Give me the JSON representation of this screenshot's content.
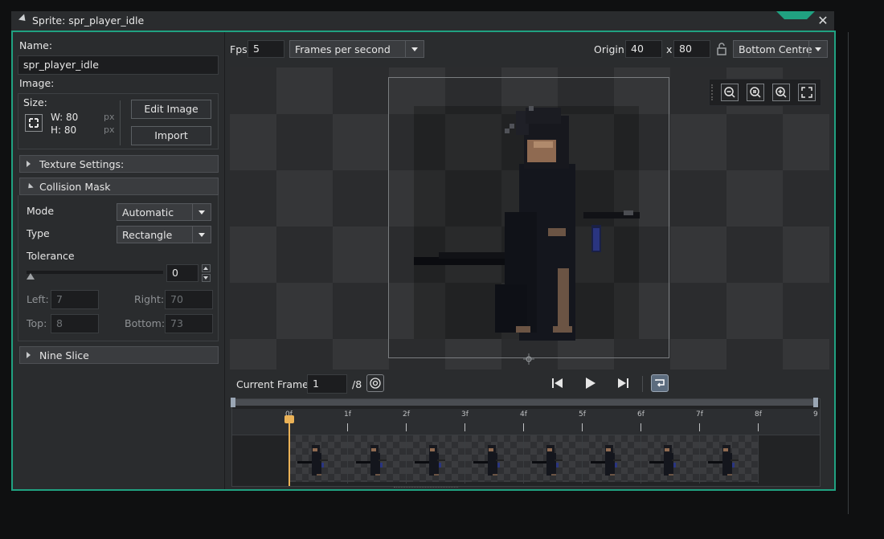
{
  "window": {
    "title": "Sprite: spr_player_idle"
  },
  "left": {
    "name_label": "Name:",
    "name_value": "spr_player_idle",
    "image_label": "Image:",
    "size_label": "Size:",
    "width": "W: 80",
    "height": "H: 80",
    "px1": "px",
    "px2": "px",
    "edit_image": "Edit Image",
    "import": "Import",
    "texture_settings": "Texture Settings:",
    "collision_mask": "Collision Mask",
    "mode_label": "Mode",
    "mode_value": "Automatic",
    "type_label": "Type",
    "type_value": "Rectangle",
    "tolerance_label": "Tolerance",
    "tolerance_value": "0",
    "left_label": "Left:",
    "left_value": "7",
    "right_label": "Right:",
    "right_value": "70",
    "top_label": "Top:",
    "top_value": "8",
    "bottom_label": "Bottom:",
    "bottom_value": "73",
    "nine_slice": "Nine Slice"
  },
  "top": {
    "fps_label": "Fps",
    "fps_value": "5",
    "fps_mode": "Frames per second",
    "origin_label": "Origin",
    "origin_x": "40",
    "x_sep": "x",
    "origin_y": "80",
    "origin_mode": "Bottom Centre"
  },
  "controls": {
    "current_frame_label": "Current Frame:",
    "current_frame_value": "1",
    "frame_total": "/8"
  },
  "timeline": {
    "ticks": [
      "0f",
      "1f",
      "2f",
      "3f",
      "4f",
      "5f",
      "6f",
      "7f",
      "8f",
      "9"
    ],
    "current_frame_index": 0,
    "frame_count": 8
  },
  "colors": {
    "accent": "#20a281",
    "playhead": "#ebb257",
    "panel": "#2a2c2e"
  },
  "icons": {
    "zoom_out": "zoom-out-icon",
    "zoom_reset": "zoom-reset-icon",
    "zoom_in": "zoom-in-icon",
    "fit": "fit-screen-icon",
    "first_frame": "skip-back-icon",
    "play": "play-icon",
    "last_frame": "skip-forward-icon",
    "loop": "loop-icon",
    "onion": "onion-skin-icon",
    "lock": "lock-icon"
  }
}
